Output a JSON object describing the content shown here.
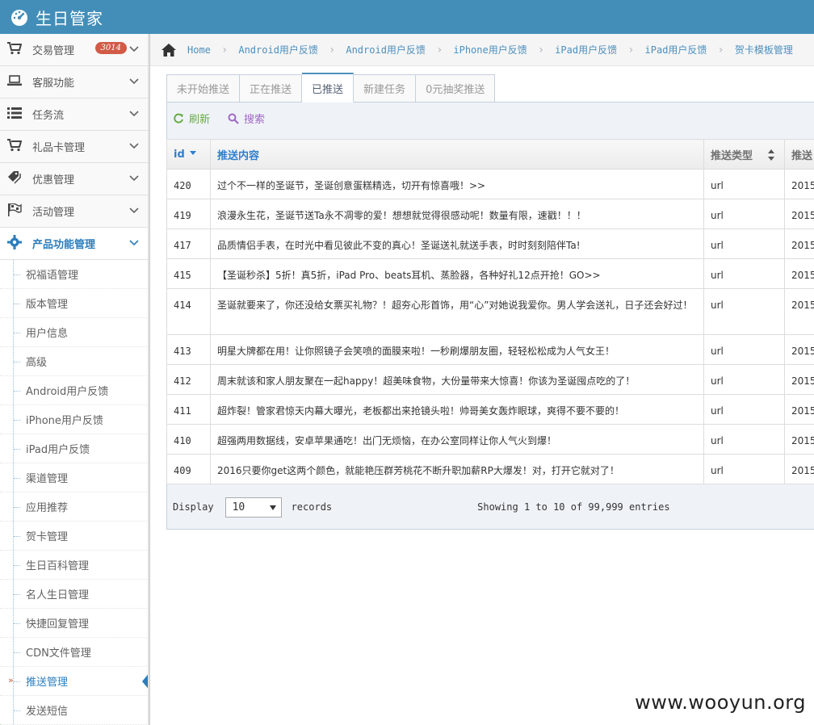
{
  "app": {
    "title": "生日管家"
  },
  "sidebar": {
    "top_items": [
      {
        "label": "交易管理",
        "badge": "3014"
      },
      {
        "label": "客服功能"
      },
      {
        "label": "任务流"
      },
      {
        "label": "礼品卡管理"
      },
      {
        "label": "优惠管理"
      },
      {
        "label": "活动管理"
      },
      {
        "label": "产品功能管理"
      }
    ],
    "sub_items": [
      "祝福语管理",
      "版本管理",
      "用户信息",
      "高级",
      "Android用户反馈",
      "iPhone用户反馈",
      "iPad用户反馈",
      "渠道管理",
      "应用推荐",
      "贺卡管理",
      "生日百科管理",
      "名人生日管理",
      "快捷回复管理",
      "CDN文件管理",
      "推送管理",
      "发送短信"
    ]
  },
  "breadcrumbs": [
    "Home",
    "Android用户反馈",
    "Android用户反馈",
    "iPhone用户反馈",
    "iPad用户反馈",
    "iPad用户反馈",
    "贺卡模板管理"
  ],
  "tabs": [
    "未开始推送",
    "正在推送",
    "已推送",
    "新建任务",
    "0元抽奖推送"
  ],
  "toolbar": {
    "refresh": "刷新",
    "search": "搜索"
  },
  "table": {
    "headers": [
      "id",
      "推送内容",
      "推送类型",
      "推送"
    ],
    "rows": [
      {
        "id": "420",
        "content": "过个不一样的圣诞节，圣诞创意蛋糕精选，切开有惊喜哦！>>",
        "type": "url",
        "time": "2015"
      },
      {
        "id": "419",
        "content": "浪漫永生花，圣诞节送Ta永不凋零的爱！想想就觉得很感动呢！数量有限，速戳！！！",
        "type": "url",
        "time": "2015"
      },
      {
        "id": "417",
        "content": "品质情侣手表，在时光中看见彼此不变的真心！圣诞送礼就送手表，时时刻刻陪伴Ta!",
        "type": "url",
        "time": "2015"
      },
      {
        "id": "415",
        "content": "【圣诞秒杀】5折！真5折，iPad Pro、beats耳机、蒸脸器，各种好礼12点开抢！GO>>",
        "type": "url",
        "time": "2015"
      },
      {
        "id": "414",
        "content": "圣诞就要来了，你还没给女票买礼物？！超夯心形首饰，用“心”对她说我爱你。男人学会送礼，日子还会好过！",
        "type": "url",
        "time": "2015"
      },
      {
        "id": "413",
        "content": "明星大牌都在用！让你照镜子会笑喷的面膜来啦！一秒刷爆朋友圈，轻轻松松成为人气女王！",
        "type": "url",
        "time": "2015"
      },
      {
        "id": "412",
        "content": "周末就该和家人朋友聚在一起happy！超美味食物，大份量带来大惊喜！你该为圣诞囤点吃的了！",
        "type": "url",
        "time": "2015"
      },
      {
        "id": "411",
        "content": "超炸裂！管家君惊天内幕大曝光，老板都出来抢镜头啦！帅哥美女轰炸眼球，爽得不要不要的！",
        "type": "url",
        "time": "2015"
      },
      {
        "id": "410",
        "content": "超强两用数据线，安卓苹果通吃！出门无烦恼，在办公室同样让你人气火到爆！",
        "type": "url",
        "time": "2015"
      },
      {
        "id": "409",
        "content": "2016只要你get这两个颜色，就能艳压群芳桃花不断升职加薪RP大爆发！对，打开它就对了！",
        "type": "url",
        "time": "2015"
      }
    ]
  },
  "pager": {
    "display": "Display",
    "page_size": "10",
    "records": "records",
    "info": "Showing 1 to 10 of 99,999 entries"
  },
  "watermark": "www.wooyun.org",
  "colors": {
    "topbar": "#438eb9",
    "accent": "#2b7dbc",
    "badge": "#d15b47"
  }
}
